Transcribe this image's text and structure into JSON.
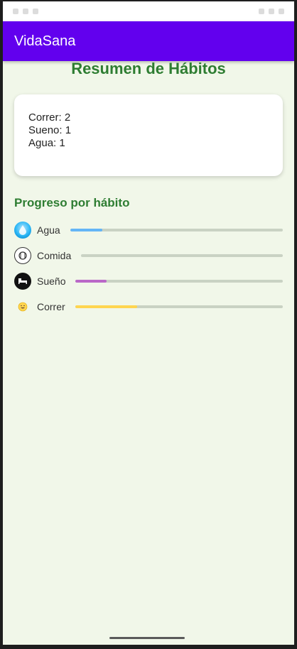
{
  "app": {
    "title": "VidaSana"
  },
  "page": {
    "title": "Resumen de Hábitos"
  },
  "summary": {
    "lines": [
      "Correr: 2",
      "Sueno: 1",
      "Agua: 1"
    ]
  },
  "progress": {
    "title": "Progreso por hábito",
    "habits": [
      {
        "label": "Agua",
        "icon": "water-drop-icon",
        "color": "#64b5f6",
        "progress": 0.15
      },
      {
        "label": "Comida",
        "icon": "food-icon",
        "color": "#9e9e9e",
        "progress": 0.0
      },
      {
        "label": "Sueño",
        "icon": "sleep-bed-icon",
        "color": "#ba68c8",
        "progress": 0.15
      },
      {
        "label": "Correr",
        "icon": "smiley-icon",
        "color": "#ffd54f",
        "progress": 0.3
      }
    ]
  },
  "colors": {
    "app_bar": "#6200ee",
    "title_green": "#2e7d32",
    "background": "#f1f7e9",
    "track": "#c9d2c3"
  }
}
